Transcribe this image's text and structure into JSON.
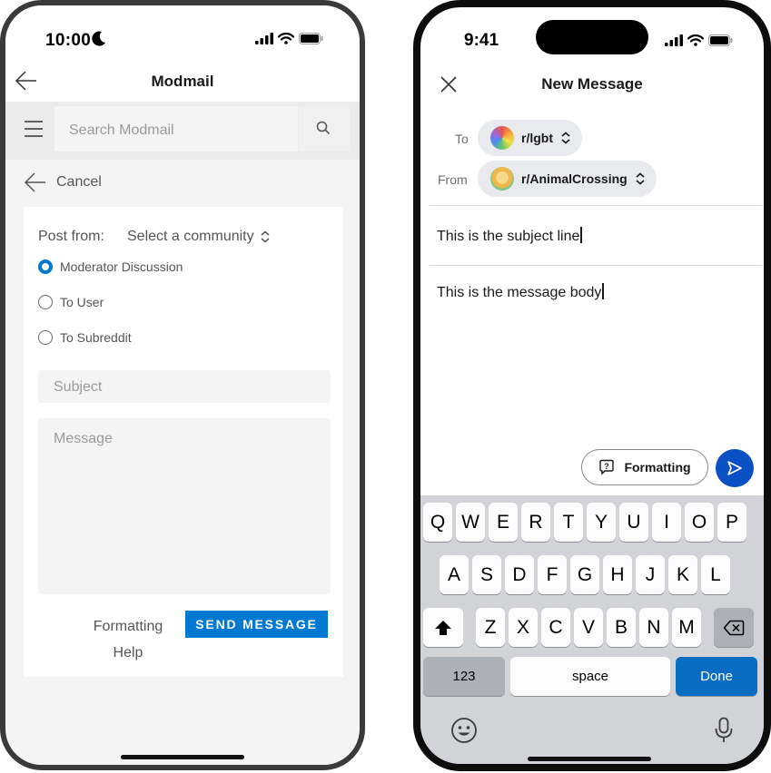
{
  "left_phone": {
    "status": {
      "time": "10:00"
    },
    "header": {
      "title": "Modmail"
    },
    "search": {
      "placeholder": "Search Modmail"
    },
    "cancel_label": "Cancel",
    "form": {
      "post_from_label": "Post from:",
      "community_select": "Select a community",
      "radio_options": [
        {
          "label": "Moderator Discussion",
          "selected": true
        },
        {
          "label": "To User",
          "selected": false
        },
        {
          "label": "To Subreddit",
          "selected": false
        }
      ],
      "subject_placeholder": "Subject",
      "message_placeholder": "Message",
      "formatting_help": "Formatting Help",
      "send_label": "SEND MESSAGE"
    },
    "colors": {
      "accent": "#0079d3"
    }
  },
  "right_phone": {
    "status": {
      "time": "9:41"
    },
    "header": {
      "title": "New Message"
    },
    "to": {
      "label": "To",
      "community": "r/lgbt"
    },
    "from": {
      "label": "From",
      "community": "r/AnimalCrossing"
    },
    "subject_value": "This is the subject line",
    "body_value": "This is the message body",
    "formatting_label": "Formatting",
    "keyboard": {
      "row1": [
        "Q",
        "W",
        "E",
        "R",
        "T",
        "Y",
        "U",
        "I",
        "O",
        "P"
      ],
      "row2": [
        "A",
        "S",
        "D",
        "F",
        "G",
        "H",
        "J",
        "K",
        "L"
      ],
      "row3": [
        "Z",
        "X",
        "C",
        "V",
        "B",
        "N",
        "M"
      ],
      "numbers_key": "123",
      "space_key": "space",
      "done_key": "Done"
    },
    "colors": {
      "send": "#0a4fc4",
      "done": "#0a6dc4"
    }
  }
}
